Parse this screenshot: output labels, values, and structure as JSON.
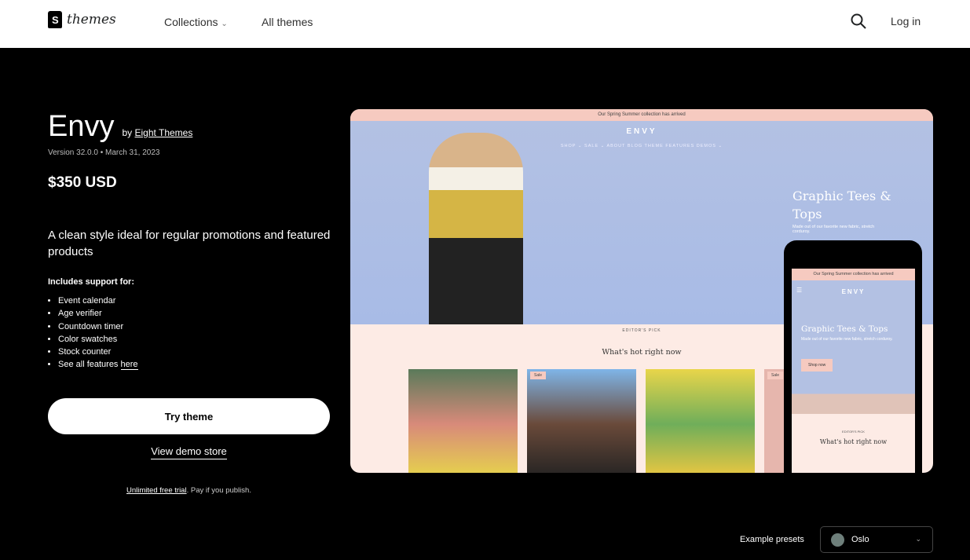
{
  "header": {
    "logo_text": "themes",
    "nav": [
      {
        "label": "Collections"
      },
      {
        "label": "All themes"
      }
    ],
    "login": "Log in"
  },
  "theme": {
    "name": "Envy",
    "by": "by",
    "author": "Eight Themes",
    "version": "Version 32.0.0 • March 31, 2023",
    "price": "$350 USD",
    "description": "A clean style ideal for regular promotions and featured products",
    "includes_label": "Includes support for:",
    "features": [
      "Event calendar",
      "Age verifier",
      "Countdown timer",
      "Color swatches",
      "Stock counter"
    ],
    "see_all": "See all features",
    "see_all_link": "here",
    "try_button": "Try theme",
    "demo_link": "View demo store",
    "trial_link": "Unlimited free trial",
    "trial_rest": ". Pay if you publish."
  },
  "preview": {
    "announcement": "Our Spring Summer collection has arrived",
    "brand": "ENVY",
    "nav": "SHOP ⌄   SALE ⌄   ABOUT   BLOG   THEME FEATURES   DEMOS ⌄",
    "hero_title": "Graphic Tees & Tops",
    "hero_sub": "Made out of our favorite new fabric, stretch corduroy.",
    "editors_pick": "EDITOR'S PICK",
    "section_title": "What's hot right now",
    "sale_badge": "Sale",
    "shop_now": "Shop now"
  },
  "presets": {
    "label": "Example presets",
    "selected": "Oslo",
    "color": "#6e7f7b"
  }
}
